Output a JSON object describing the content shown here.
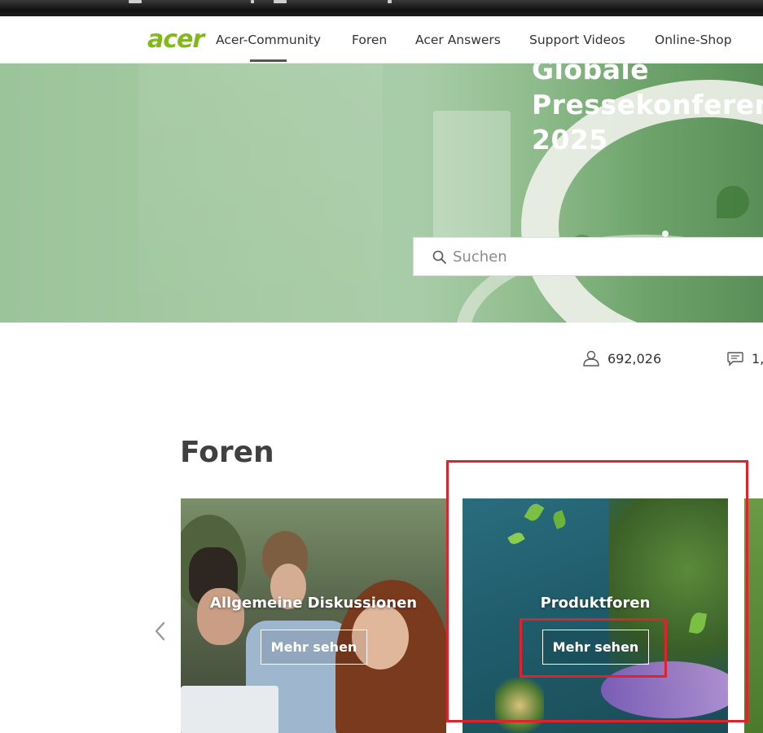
{
  "nav": {
    "logo_text": "acer",
    "items": [
      {
        "label": "Acer-Community",
        "active": true
      },
      {
        "label": "Foren"
      },
      {
        "label": "Acer Answers"
      },
      {
        "label": "Support Videos"
      },
      {
        "label": "Online-Shop"
      }
    ]
  },
  "hero": {
    "title_lines": [
      "Globale",
      "Pressekonferenz",
      "2025"
    ]
  },
  "search": {
    "placeholder": "Suchen",
    "icon": "search-icon"
  },
  "stats": {
    "members": "692,026",
    "members_icon": "user-icon",
    "posts": "1,",
    "posts_icon": "comment-icon"
  },
  "forums": {
    "title": "Foren",
    "cards": [
      {
        "title": "Allgemeine Diskussionen",
        "button": "Mehr sehen"
      },
      {
        "title": "Produktforen",
        "button": "Mehr sehen"
      }
    ],
    "prev_icon": "chevron-left-icon"
  },
  "colors": {
    "brand": "#83b81a",
    "highlight": "#e0222b"
  }
}
